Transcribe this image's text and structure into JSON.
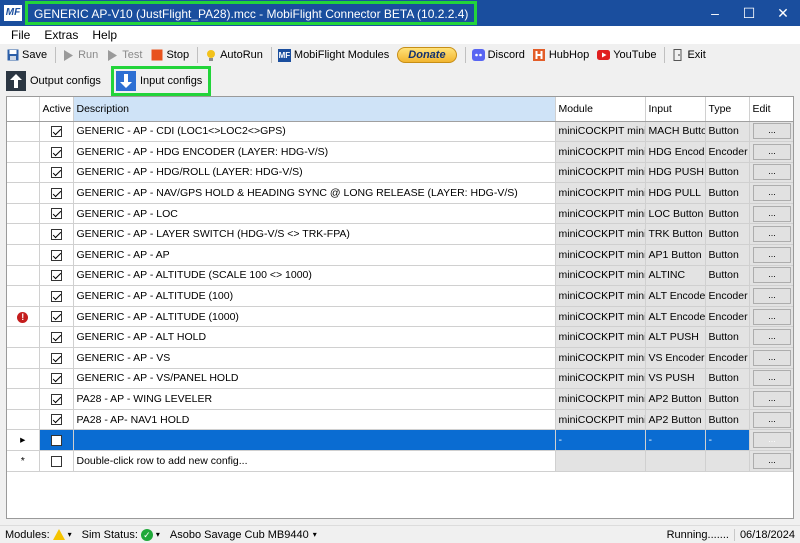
{
  "window": {
    "title": "GENERIC AP-V10 (JustFlight_PA28).mcc - MobiFlight Connector BETA (10.2.2.4)",
    "icon_text": "MF",
    "minimize": "–",
    "maximize": "☐",
    "close": "✕"
  },
  "menu": [
    "File",
    "Extras",
    "Help"
  ],
  "toolbar": {
    "save": "Save",
    "run": "Run",
    "test": "Test",
    "stop": "Stop",
    "autorun": "AutoRun",
    "modules": "MobiFlight Modules",
    "donate": "Donate",
    "discord": "Discord",
    "hubhop": "HubHop",
    "youtube": "YouTube",
    "exit": "Exit"
  },
  "tabs": {
    "output": "Output configs",
    "input": "Input configs"
  },
  "grid": {
    "columns": [
      "Active",
      "Description",
      "Module",
      "Input",
      "Type",
      "Edit"
    ],
    "edit_label": "...",
    "rows": [
      {
        "active": true,
        "description": "GENERIC - AP - CDI (LOC1<>LOC2<>GPS)",
        "module": "miniCOCKPIT miniFCU",
        "input": "MACH Button",
        "type": "Button",
        "error": false
      },
      {
        "active": true,
        "description": "GENERIC - AP - HDG ENCODER (LAYER: HDG-V/S)",
        "module": "miniCOCKPIT miniFCU",
        "input": "HDG Encoder",
        "type": "Encoder",
        "error": false
      },
      {
        "active": true,
        "description": "GENERIC - AP - HDG/ROLL (LAYER: HDG-V/S)",
        "module": "miniCOCKPIT miniFCU",
        "input": "HDG PUSH",
        "type": "Button",
        "error": false
      },
      {
        "active": true,
        "description": "GENERIC - AP - NAV/GPS HOLD & HEADING SYNC @ LONG RELEASE (LAYER: HDG-V/S)",
        "module": "miniCOCKPIT miniFCU",
        "input": "HDG PULL",
        "type": "Button",
        "error": false
      },
      {
        "active": true,
        "description": "GENERIC - AP - LOC",
        "module": "miniCOCKPIT miniFCU",
        "input": "LOC Button",
        "type": "Button",
        "error": false
      },
      {
        "active": true,
        "description": "GENERIC - AP - LAYER SWITCH (HDG-V/S <> TRK-FPA)",
        "module": "miniCOCKPIT miniFCU",
        "input": "TRK Button",
        "type": "Button",
        "error": false
      },
      {
        "active": true,
        "description": "GENERIC - AP - AP",
        "module": "miniCOCKPIT miniFCU",
        "input": "AP1 Button",
        "type": "Button",
        "error": false
      },
      {
        "active": true,
        "description": "GENERIC - AP - ALTITUDE (SCALE 100 <> 1000)",
        "module": "miniCOCKPIT miniFCU",
        "input": "ALTINC",
        "type": "Button",
        "error": false
      },
      {
        "active": true,
        "description": "GENERIC - AP - ALTITUDE (100)",
        "module": "miniCOCKPIT miniFCU",
        "input": "ALT Encoder",
        "type": "Encoder",
        "error": false
      },
      {
        "active": true,
        "description": "GENERIC - AP - ALTITUDE (1000)",
        "module": "miniCOCKPIT miniFCU",
        "input": "ALT Encoder",
        "type": "Encoder",
        "error": true
      },
      {
        "active": true,
        "description": "GENERIC - AP - ALT HOLD",
        "module": "miniCOCKPIT miniFCU",
        "input": "ALT PUSH",
        "type": "Button",
        "error": false
      },
      {
        "active": true,
        "description": "GENERIC - AP - VS",
        "module": "miniCOCKPIT miniFCU",
        "input": "VS Encoder",
        "type": "Encoder",
        "error": false
      },
      {
        "active": true,
        "description": "GENERIC - AP - VS/PANEL HOLD",
        "module": "miniCOCKPIT miniFCU",
        "input": "VS PUSH",
        "type": "Button",
        "error": false
      },
      {
        "active": true,
        "description": "PA28 - AP - WING LEVELER",
        "module": "miniCOCKPIT miniFCU",
        "input": "AP2 Button",
        "type": "Button",
        "error": false
      },
      {
        "active": true,
        "description": "PA28 - AP- NAV1 HOLD",
        "module": "miniCOCKPIT miniFCU",
        "input": "AP2 Button",
        "type": "Button",
        "error": false
      }
    ],
    "selected_row": {
      "active": false,
      "description": "",
      "module": "-",
      "input": "-",
      "type": "-"
    },
    "new_row": {
      "description": "Double-click row to add new config..."
    }
  },
  "status": {
    "modules_label": "Modules:",
    "sim_label": "Sim Status:",
    "aircraft": "Asobo Savage Cub MB9440",
    "running": "Running.......",
    "date": "06/18/2024"
  },
  "colors": {
    "titlebar": "#1a4e9e",
    "highlight": "#22d43a",
    "selection": "#0a6cd2"
  }
}
